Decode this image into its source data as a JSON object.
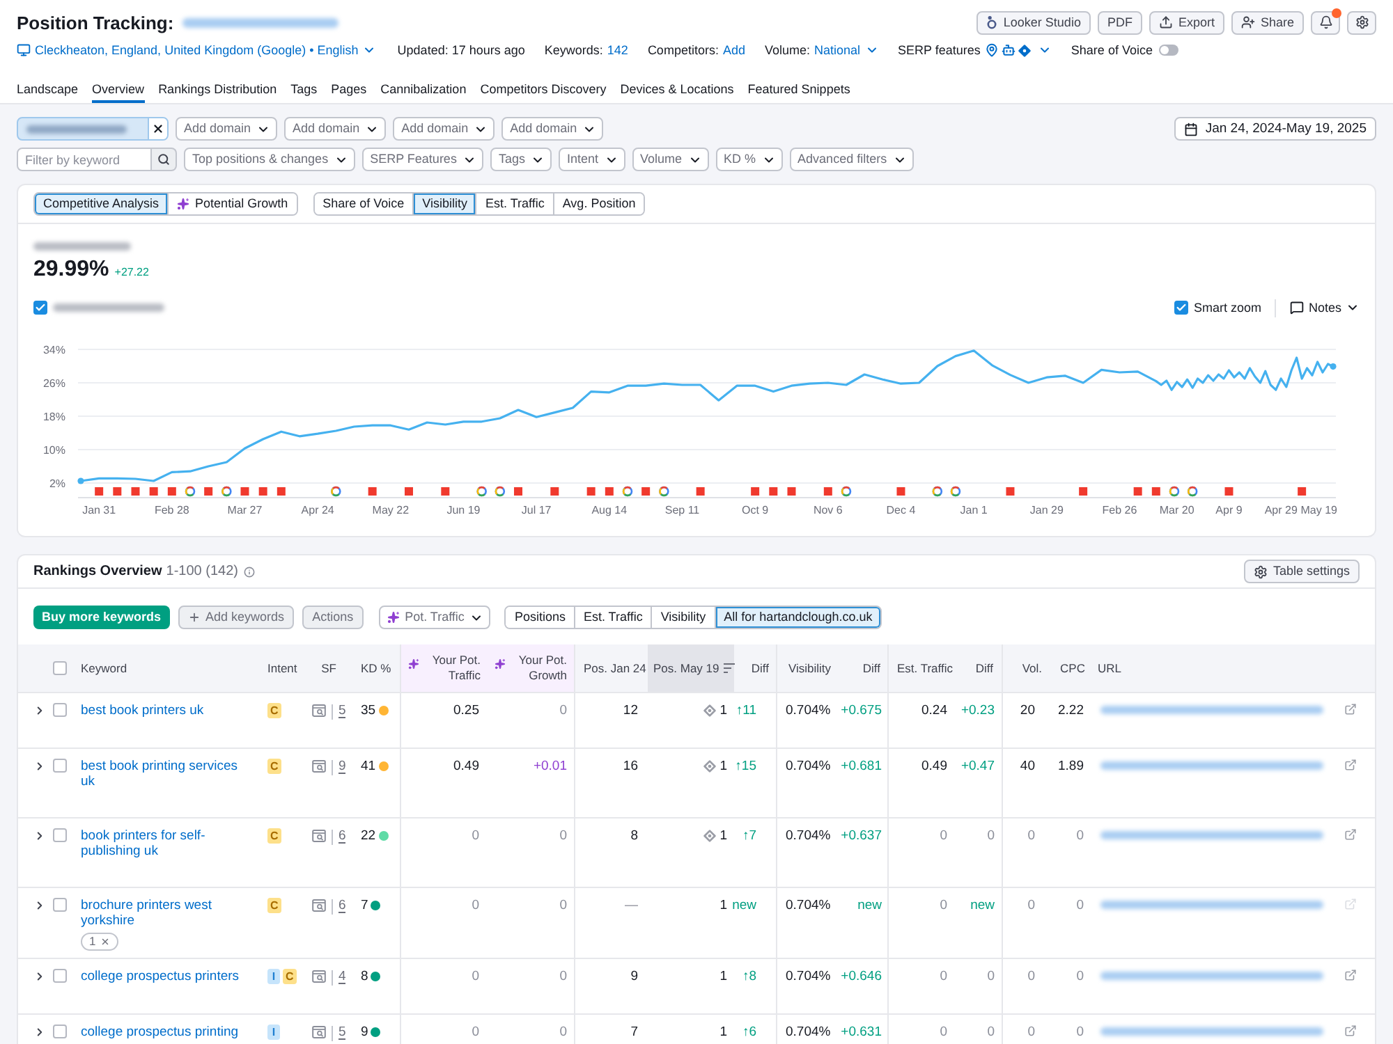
{
  "header": {
    "title": "Position Tracking:",
    "buttons": [
      {
        "kind": "looker",
        "label": "Looker Studio"
      },
      {
        "kind": "pdf",
        "label": "PDF"
      },
      {
        "kind": "export",
        "label": "Export"
      },
      {
        "kind": "share",
        "label": "Share"
      }
    ],
    "notifications": {
      "unread": true
    }
  },
  "info_bar": {
    "location": "Cleckheaton, England, United Kingdom (Google) • English",
    "updated": "Updated: 17 hours ago",
    "keywords_label": "Keywords:",
    "keywords_value": "142",
    "competitors_label": "Competitors:",
    "competitors_value": "Add",
    "volume_label": "Volume:",
    "volume_value": "National",
    "serp_label": "SERP features",
    "share_of_voice": {
      "label": "Share of Voice",
      "on": false
    }
  },
  "tabs": [
    {
      "label": "Landscape",
      "selected": false
    },
    {
      "label": "Overview",
      "selected": true
    },
    {
      "label": "Rankings Distribution",
      "selected": false
    },
    {
      "label": "Tags",
      "selected": false
    },
    {
      "label": "Pages",
      "selected": false
    },
    {
      "label": "Cannibalization",
      "selected": false
    },
    {
      "label": "Competitors Discovery",
      "selected": false
    },
    {
      "label": "Devices & Locations",
      "selected": false
    },
    {
      "label": "Featured Snippets",
      "selected": false
    }
  ],
  "domain_bar": {
    "add_domain": [
      "Add domain",
      "Add domain",
      "Add domain",
      "Add domain"
    ],
    "date_range": "Jan 24, 2024-May 19, 2025"
  },
  "filter_bar": {
    "keyword": {
      "placeholder": "Filter by keyword"
    },
    "dropdowns": [
      "Top positions & changes",
      "SERP Features",
      "Tags",
      "Intent",
      "Volume",
      "KD %",
      "Advanced filters"
    ]
  },
  "chart_panel": {
    "modes": [
      {
        "label": "Competitive Analysis",
        "selected": true,
        "ai": false
      },
      {
        "label": "Potential Growth",
        "selected": false,
        "ai": true
      }
    ],
    "metrics": [
      {
        "label": "Share of Voice",
        "selected": false
      },
      {
        "label": "Visibility",
        "selected": true
      },
      {
        "label": "Est. Traffic",
        "selected": false
      },
      {
        "label": "Avg. Position",
        "selected": false
      }
    ],
    "value": "29.99%",
    "change": "+27.22",
    "legend": {
      "checked": true
    },
    "smart_zoom": {
      "label": "Smart zoom",
      "checked": true
    },
    "notes": "Notes",
    "chart_data": {
      "type": "line",
      "xlim": [
        "2024-01-24",
        "2025-05-19"
      ],
      "ylim": [
        -1.5,
        34
      ],
      "xticks": [
        {
          "value": "2024-01-31",
          "label": "Jan 31"
        },
        {
          "value": "2024-02-28",
          "label": "Feb 28"
        },
        {
          "value": "2024-03-27",
          "label": "Mar 27"
        },
        {
          "value": "2024-04-24",
          "label": "Apr 24"
        },
        {
          "value": "2024-05-22",
          "label": "May 22"
        },
        {
          "value": "2024-06-19",
          "label": "Jun 19"
        },
        {
          "value": "2024-07-17",
          "label": "Jul 17"
        },
        {
          "value": "2024-08-14",
          "label": "Aug 14"
        },
        {
          "value": "2024-09-11",
          "label": "Sep 11"
        },
        {
          "value": "2024-10-09",
          "label": "Oct 9"
        },
        {
          "value": "2024-11-06",
          "label": "Nov 6"
        },
        {
          "value": "2024-12-04",
          "label": "Dec 4"
        },
        {
          "value": "2025-01-01",
          "label": "Jan 1"
        },
        {
          "value": "2025-01-29",
          "label": "Jan 29"
        },
        {
          "value": "2025-02-26",
          "label": "Feb 26"
        },
        {
          "value": "2025-03-20",
          "label": "Mar 20"
        },
        {
          "value": "2025-04-09",
          "label": "Apr 9"
        },
        {
          "value": "2025-04-29",
          "label": "Apr 29"
        },
        {
          "value": "2025-05-19",
          "label": "May 19"
        }
      ],
      "yticks": [
        {
          "value": 2,
          "label": "2%"
        },
        {
          "value": 10,
          "label": "10%"
        },
        {
          "value": 18,
          "label": "18%"
        },
        {
          "value": 26,
          "label": "26%"
        },
        {
          "value": 34,
          "label": "34%"
        }
      ],
      "grid": true,
      "series": [
        {
          "color": "#45b1ef",
          "x": [
            "2024-01-24",
            "2024-01-31",
            "2024-02-07",
            "2024-02-14",
            "2024-02-21",
            "2024-02-28",
            "2024-03-06",
            "2024-03-13",
            "2024-03-20",
            "2024-03-27",
            "2024-04-03",
            "2024-04-10",
            "2024-04-17",
            "2024-04-24",
            "2024-05-01",
            "2024-05-08",
            "2024-05-15",
            "2024-05-22",
            "2024-05-29",
            "2024-06-05",
            "2024-06-12",
            "2024-06-19",
            "2024-06-26",
            "2024-07-03",
            "2024-07-10",
            "2024-07-17",
            "2024-07-24",
            "2024-07-31",
            "2024-08-07",
            "2024-08-14",
            "2024-08-21",
            "2024-08-28",
            "2024-09-04",
            "2024-09-11",
            "2024-09-18",
            "2024-09-25",
            "2024-10-02",
            "2024-10-09",
            "2024-10-16",
            "2024-10-23",
            "2024-10-30",
            "2024-11-06",
            "2024-11-13",
            "2024-11-20",
            "2024-11-27",
            "2024-12-04",
            "2024-12-11",
            "2024-12-18",
            "2024-12-25",
            "2025-01-01",
            "2025-01-08",
            "2025-01-15",
            "2025-01-22",
            "2025-01-29",
            "2025-02-05",
            "2025-02-12",
            "2025-02-19",
            "2025-02-26",
            "2025-03-05",
            "2025-03-12",
            "2025-03-14",
            "2025-03-16",
            "2025-03-18",
            "2025-03-20",
            "2025-03-22",
            "2025-03-24",
            "2025-03-26",
            "2025-03-28",
            "2025-03-30",
            "2025-04-01",
            "2025-04-03",
            "2025-04-05",
            "2025-04-07",
            "2025-04-09",
            "2025-04-11",
            "2025-04-13",
            "2025-04-15",
            "2025-04-17",
            "2025-04-19",
            "2025-04-21",
            "2025-04-23",
            "2025-04-25",
            "2025-04-27",
            "2025-04-29",
            "2025-05-01",
            "2025-05-03",
            "2025-05-05",
            "2025-05-07",
            "2025-05-09",
            "2025-05-11",
            "2025-05-13",
            "2025-05-15",
            "2025-05-17",
            "2025-05-19"
          ],
          "values": [
            2.5,
            3.1,
            3.1,
            3.0,
            2.5,
            4.6,
            4.8,
            6.0,
            7.0,
            10.3,
            12.5,
            14.3,
            13.2,
            13.8,
            14.5,
            15.5,
            15.8,
            15.8,
            14.8,
            16.5,
            16.0,
            16.7,
            16.7,
            17.5,
            19.5,
            17.8,
            18.9,
            20.0,
            23.9,
            23.7,
            25.3,
            25.3,
            25.8,
            25.5,
            25.5,
            21.8,
            25.3,
            25.3,
            23.9,
            25.3,
            25.8,
            26.0,
            25.5,
            28.0,
            26.8,
            25.8,
            26.0,
            30.0,
            32.4,
            33.7,
            30.2,
            27.9,
            26.0,
            27.3,
            27.7,
            26.0,
            29.1,
            28.5,
            28.7,
            26.4,
            25.5,
            26.5,
            24.3,
            26.2,
            25.0,
            26.8,
            24.8,
            27.0,
            26.0,
            27.8,
            26.5,
            28.0,
            27.0,
            29.0,
            27.3,
            28.5,
            27.0,
            29.5,
            27.5,
            26.0,
            28.8,
            25.5,
            24.3,
            27.0,
            25.0,
            29.0,
            32.0,
            27.0,
            29.5,
            27.8,
            31.0,
            28.5,
            30.5,
            29.9
          ]
        },
        {
          "type": "scatter",
          "marker": "square",
          "color": "#f03a2e",
          "x": [
            "2024-01-31",
            "2024-02-07",
            "2024-02-14",
            "2024-02-21",
            "2024-02-28",
            "2024-03-13",
            "2024-03-27",
            "2024-04-03",
            "2024-04-10",
            "2024-05-15",
            "2024-05-29",
            "2024-06-12",
            "2024-07-10",
            "2024-07-24",
            "2024-08-07",
            "2024-08-14",
            "2024-08-28",
            "2024-09-18",
            "2024-10-09",
            "2024-10-16",
            "2024-10-23",
            "2024-11-06",
            "2024-12-04",
            "2025-01-15",
            "2025-02-12",
            "2025-03-05",
            "2025-03-12",
            "2025-04-09",
            "2025-05-07"
          ],
          "values": [
            0,
            0,
            0,
            0,
            0,
            0,
            0,
            0,
            0,
            0,
            0,
            0,
            0,
            0,
            0,
            0,
            0,
            0,
            0,
            0,
            0,
            0,
            0,
            0,
            0,
            0,
            0,
            0,
            0
          ]
        },
        {
          "type": "scatter",
          "marker": "circle",
          "x": [
            "2024-03-06",
            "2024-03-20",
            "2024-05-01",
            "2024-06-26",
            "2024-07-03",
            "2024-08-21",
            "2024-09-04",
            "2024-11-13",
            "2024-12-18",
            "2024-12-25",
            "2025-03-19",
            "2025-03-26"
          ],
          "values": [
            0,
            0,
            0,
            0,
            0,
            0,
            0,
            0,
            0,
            0,
            0,
            0
          ]
        }
      ]
    }
  },
  "rankings": {
    "title": "Rankings Overview",
    "range": "1-100 (142)",
    "table_settings": "Table settings",
    "buy": "Buy more keywords",
    "add": "Add keywords",
    "actions": "Actions",
    "pot_dropdown": "Pot. Traffic",
    "views": [
      {
        "label": "Positions",
        "selected": false
      },
      {
        "label": "Est. Traffic",
        "selected": false
      },
      {
        "label": "Visibility",
        "selected": false
      },
      {
        "label": "All for hartandclough.co.uk",
        "selected": true
      }
    ],
    "table": {
      "select_all": false,
      "columns": [
        {
          "label": "Keyword",
          "kind": "plain",
          "sorted": false
        },
        {
          "label": "Intent",
          "kind": "plain",
          "sorted": false
        },
        {
          "label": "SF",
          "kind": "plain",
          "sorted": false
        },
        {
          "label": "KD %",
          "kind": "plain",
          "sorted": false
        },
        {
          "label": "Your Pot. Traffic",
          "kind": "potential",
          "sorted": false
        },
        {
          "label": "Your Pot. Growth",
          "kind": "potential",
          "sorted": false
        },
        {
          "label": "Pos. Jan 24",
          "kind": "plain",
          "sorted": false
        },
        {
          "label": "Pos. May 19",
          "kind": "plain",
          "sorted": true
        },
        {
          "label": "Diff",
          "kind": "plain",
          "sorted": false
        },
        {
          "label": "Visibility",
          "kind": "plain",
          "sorted": false
        },
        {
          "label": "Diff",
          "kind": "plain",
          "sorted": false
        },
        {
          "label": "Est. Traffic",
          "kind": "plain",
          "sorted": false
        },
        {
          "label": "Diff",
          "kind": "plain",
          "sorted": false
        },
        {
          "label": "Vol.",
          "kind": "plain",
          "sorted": false
        },
        {
          "label": "CPC",
          "kind": "plain",
          "sorted": false
        },
        {
          "label": "URL",
          "kind": "plain",
          "sorted": false
        }
      ],
      "rows": [
        {
          "expanded": false,
          "checked": false,
          "keyword": "best book printers uk",
          "intents": [
            {
              "kind": "commercial",
              "label": "C"
            }
          ],
          "sf": "5",
          "kd": {
            "value": "35",
            "color": "#ffb534"
          },
          "featured": true,
          "link_faded": false,
          "metrics": [
            {
              "text": "0.25",
              "kind": "normal"
            },
            {
              "text": "0",
              "kind": "muted"
            },
            {
              "text": "12",
              "kind": "normal"
            },
            {
              "text": "1",
              "kind": "normal"
            },
            {
              "text": "↑11",
              "kind": "up"
            },
            {
              "text": "0.704%",
              "kind": "normal"
            },
            {
              "text": "+0.675",
              "kind": "up"
            },
            {
              "text": "0.24",
              "kind": "normal"
            },
            {
              "text": "+0.23",
              "kind": "up"
            },
            {
              "text": "20",
              "kind": "normal"
            },
            {
              "text": "2.22",
              "kind": "normal"
            }
          ]
        },
        {
          "expanded": false,
          "checked": false,
          "keyword": "best book printing services uk",
          "intents": [
            {
              "kind": "commercial",
              "label": "C"
            }
          ],
          "sf": "9",
          "kd": {
            "value": "41",
            "color": "#ffb534"
          },
          "featured": true,
          "link_faded": false,
          "metrics": [
            {
              "text": "0.49",
              "kind": "normal"
            },
            {
              "text": "+0.01",
              "kind": "growth"
            },
            {
              "text": "16",
              "kind": "normal"
            },
            {
              "text": "1",
              "kind": "normal"
            },
            {
              "text": "↑15",
              "kind": "up"
            },
            {
              "text": "0.704%",
              "kind": "normal"
            },
            {
              "text": "+0.681",
              "kind": "up"
            },
            {
              "text": "0.49",
              "kind": "normal"
            },
            {
              "text": "+0.47",
              "kind": "up"
            },
            {
              "text": "40",
              "kind": "normal"
            },
            {
              "text": "1.89",
              "kind": "normal"
            }
          ]
        },
        {
          "expanded": false,
          "checked": false,
          "keyword": "book printers for self-publishing uk",
          "intents": [
            {
              "kind": "commercial",
              "label": "C"
            }
          ],
          "sf": "6",
          "kd": {
            "value": "22",
            "color": "#5fdba6"
          },
          "featured": true,
          "link_faded": false,
          "metrics": [
            {
              "text": "0",
              "kind": "muted"
            },
            {
              "text": "0",
              "kind": "muted"
            },
            {
              "text": "8",
              "kind": "normal"
            },
            {
              "text": "1",
              "kind": "normal"
            },
            {
              "text": "↑7",
              "kind": "up"
            },
            {
              "text": "0.704%",
              "kind": "normal"
            },
            {
              "text": "+0.637",
              "kind": "up"
            },
            {
              "text": "0",
              "kind": "muted"
            },
            {
              "text": "0",
              "kind": "muted"
            },
            {
              "text": "0",
              "kind": "muted"
            },
            {
              "text": "0",
              "kind": "muted"
            }
          ]
        },
        {
          "expanded": false,
          "checked": false,
          "keyword": "brochure printers west yorkshire",
          "tags": [
            {
              "label": "1"
            }
          ],
          "intents": [
            {
              "kind": "commercial",
              "label": "C"
            }
          ],
          "sf": "6",
          "kd": {
            "value": "7",
            "color": "#009f81"
          },
          "featured": false,
          "link_faded": true,
          "metrics": [
            {
              "text": "0",
              "kind": "muted"
            },
            {
              "text": "0",
              "kind": "muted"
            },
            {
              "text": "—",
              "kind": "muted"
            },
            {
              "text": "1",
              "kind": "normal"
            },
            {
              "text": "new",
              "kind": "up"
            },
            {
              "text": "0.704%",
              "kind": "normal"
            },
            {
              "text": "new",
              "kind": "up"
            },
            {
              "text": "0",
              "kind": "muted"
            },
            {
              "text": "new",
              "kind": "up"
            },
            {
              "text": "0",
              "kind": "muted"
            },
            {
              "text": "0",
              "kind": "muted"
            }
          ]
        },
        {
          "expanded": false,
          "checked": false,
          "keyword": "college prospectus printers",
          "intents": [
            {
              "kind": "informational",
              "label": "I"
            },
            {
              "kind": "commercial",
              "label": "C"
            }
          ],
          "sf": "4",
          "kd": {
            "value": "8",
            "color": "#009f81"
          },
          "featured": false,
          "link_faded": false,
          "metrics": [
            {
              "text": "0",
              "kind": "muted"
            },
            {
              "text": "0",
              "kind": "muted"
            },
            {
              "text": "9",
              "kind": "normal"
            },
            {
              "text": "1",
              "kind": "normal"
            },
            {
              "text": "↑8",
              "kind": "up"
            },
            {
              "text": "0.704%",
              "kind": "normal"
            },
            {
              "text": "+0.646",
              "kind": "up"
            },
            {
              "text": "0",
              "kind": "muted"
            },
            {
              "text": "0",
              "kind": "muted"
            },
            {
              "text": "0",
              "kind": "muted"
            },
            {
              "text": "0",
              "kind": "muted"
            }
          ]
        },
        {
          "expanded": false,
          "checked": false,
          "keyword": "college prospectus printing",
          "intents": [
            {
              "kind": "informational",
              "label": "I"
            }
          ],
          "sf": "5",
          "kd": {
            "value": "9",
            "color": "#009f81"
          },
          "featured": false,
          "link_faded": false,
          "metrics": [
            {
              "text": "0",
              "kind": "muted"
            },
            {
              "text": "0",
              "kind": "muted"
            },
            {
              "text": "7",
              "kind": "normal"
            },
            {
              "text": "1",
              "kind": "normal"
            },
            {
              "text": "↑6",
              "kind": "up"
            },
            {
              "text": "0.704%",
              "kind": "normal"
            },
            {
              "text": "+0.631",
              "kind": "up"
            },
            {
              "text": "0",
              "kind": "muted"
            },
            {
              "text": "0",
              "kind": "muted"
            },
            {
              "text": "0",
              "kind": "muted"
            },
            {
              "text": "0",
              "kind": "muted"
            }
          ]
        }
      ]
    }
  }
}
